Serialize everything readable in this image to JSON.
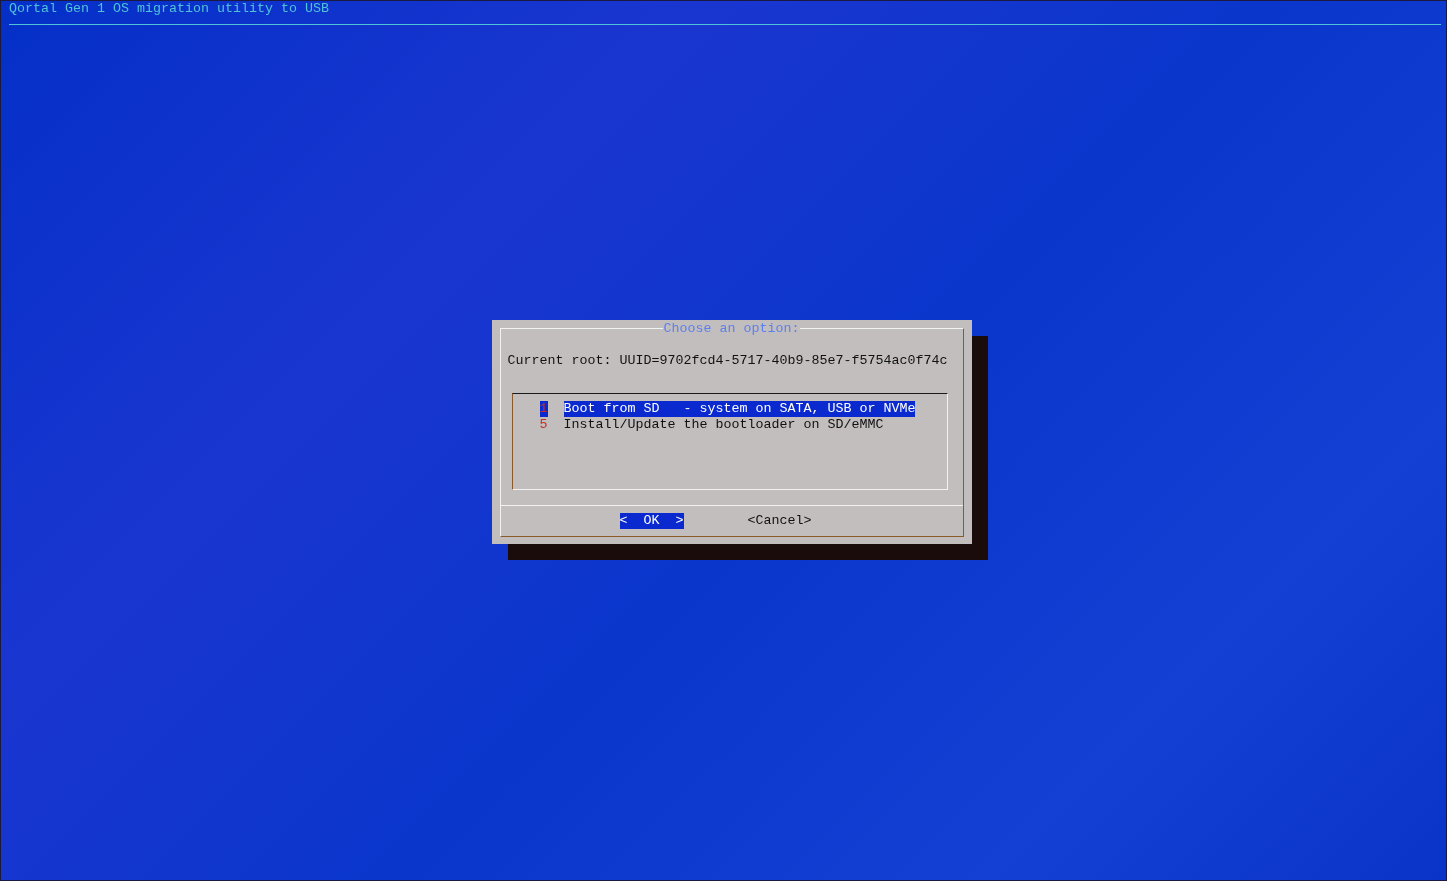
{
  "screen_title": "Qortal Gen 1 OS migration utility to USB",
  "dialog": {
    "title": "Choose an option:",
    "message": "Current root: UUID=9702fcd4-5717-40b9-85e7-f5754ac0f74c",
    "menu_items": [
      {
        "tag": "1",
        "text": "Boot from SD   - system on SATA, USB or NVMe",
        "selected": true
      },
      {
        "tag": "5",
        "text": "Install/Update the bootloader on SD/eMMC",
        "selected": false
      }
    ],
    "buttons": [
      {
        "label": "<  OK  >",
        "selected": true
      },
      {
        "label": "<Cancel>",
        "selected": false
      }
    ]
  }
}
